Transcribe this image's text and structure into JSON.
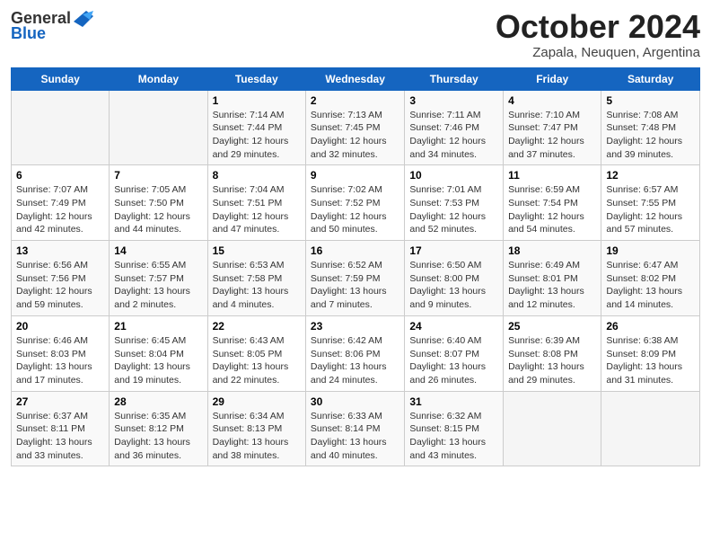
{
  "header": {
    "logo_general": "General",
    "logo_blue": "Blue",
    "month_title": "October 2024",
    "subtitle": "Zapala, Neuquen, Argentina"
  },
  "days_of_week": [
    "Sunday",
    "Monday",
    "Tuesday",
    "Wednesday",
    "Thursday",
    "Friday",
    "Saturday"
  ],
  "weeks": [
    [
      {
        "day": "",
        "sunrise": "",
        "sunset": "",
        "daylight": ""
      },
      {
        "day": "",
        "sunrise": "",
        "sunset": "",
        "daylight": ""
      },
      {
        "day": "1",
        "sunrise": "Sunrise: 7:14 AM",
        "sunset": "Sunset: 7:44 PM",
        "daylight": "Daylight: 12 hours and 29 minutes."
      },
      {
        "day": "2",
        "sunrise": "Sunrise: 7:13 AM",
        "sunset": "Sunset: 7:45 PM",
        "daylight": "Daylight: 12 hours and 32 minutes."
      },
      {
        "day": "3",
        "sunrise": "Sunrise: 7:11 AM",
        "sunset": "Sunset: 7:46 PM",
        "daylight": "Daylight: 12 hours and 34 minutes."
      },
      {
        "day": "4",
        "sunrise": "Sunrise: 7:10 AM",
        "sunset": "Sunset: 7:47 PM",
        "daylight": "Daylight: 12 hours and 37 minutes."
      },
      {
        "day": "5",
        "sunrise": "Sunrise: 7:08 AM",
        "sunset": "Sunset: 7:48 PM",
        "daylight": "Daylight: 12 hours and 39 minutes."
      }
    ],
    [
      {
        "day": "6",
        "sunrise": "Sunrise: 7:07 AM",
        "sunset": "Sunset: 7:49 PM",
        "daylight": "Daylight: 12 hours and 42 minutes."
      },
      {
        "day": "7",
        "sunrise": "Sunrise: 7:05 AM",
        "sunset": "Sunset: 7:50 PM",
        "daylight": "Daylight: 12 hours and 44 minutes."
      },
      {
        "day": "8",
        "sunrise": "Sunrise: 7:04 AM",
        "sunset": "Sunset: 7:51 PM",
        "daylight": "Daylight: 12 hours and 47 minutes."
      },
      {
        "day": "9",
        "sunrise": "Sunrise: 7:02 AM",
        "sunset": "Sunset: 7:52 PM",
        "daylight": "Daylight: 12 hours and 50 minutes."
      },
      {
        "day": "10",
        "sunrise": "Sunrise: 7:01 AM",
        "sunset": "Sunset: 7:53 PM",
        "daylight": "Daylight: 12 hours and 52 minutes."
      },
      {
        "day": "11",
        "sunrise": "Sunrise: 6:59 AM",
        "sunset": "Sunset: 7:54 PM",
        "daylight": "Daylight: 12 hours and 54 minutes."
      },
      {
        "day": "12",
        "sunrise": "Sunrise: 6:57 AM",
        "sunset": "Sunset: 7:55 PM",
        "daylight": "Daylight: 12 hours and 57 minutes."
      }
    ],
    [
      {
        "day": "13",
        "sunrise": "Sunrise: 6:56 AM",
        "sunset": "Sunset: 7:56 PM",
        "daylight": "Daylight: 12 hours and 59 minutes."
      },
      {
        "day": "14",
        "sunrise": "Sunrise: 6:55 AM",
        "sunset": "Sunset: 7:57 PM",
        "daylight": "Daylight: 13 hours and 2 minutes."
      },
      {
        "day": "15",
        "sunrise": "Sunrise: 6:53 AM",
        "sunset": "Sunset: 7:58 PM",
        "daylight": "Daylight: 13 hours and 4 minutes."
      },
      {
        "day": "16",
        "sunrise": "Sunrise: 6:52 AM",
        "sunset": "Sunset: 7:59 PM",
        "daylight": "Daylight: 13 hours and 7 minutes."
      },
      {
        "day": "17",
        "sunrise": "Sunrise: 6:50 AM",
        "sunset": "Sunset: 8:00 PM",
        "daylight": "Daylight: 13 hours and 9 minutes."
      },
      {
        "day": "18",
        "sunrise": "Sunrise: 6:49 AM",
        "sunset": "Sunset: 8:01 PM",
        "daylight": "Daylight: 13 hours and 12 minutes."
      },
      {
        "day": "19",
        "sunrise": "Sunrise: 6:47 AM",
        "sunset": "Sunset: 8:02 PM",
        "daylight": "Daylight: 13 hours and 14 minutes."
      }
    ],
    [
      {
        "day": "20",
        "sunrise": "Sunrise: 6:46 AM",
        "sunset": "Sunset: 8:03 PM",
        "daylight": "Daylight: 13 hours and 17 minutes."
      },
      {
        "day": "21",
        "sunrise": "Sunrise: 6:45 AM",
        "sunset": "Sunset: 8:04 PM",
        "daylight": "Daylight: 13 hours and 19 minutes."
      },
      {
        "day": "22",
        "sunrise": "Sunrise: 6:43 AM",
        "sunset": "Sunset: 8:05 PM",
        "daylight": "Daylight: 13 hours and 22 minutes."
      },
      {
        "day": "23",
        "sunrise": "Sunrise: 6:42 AM",
        "sunset": "Sunset: 8:06 PM",
        "daylight": "Daylight: 13 hours and 24 minutes."
      },
      {
        "day": "24",
        "sunrise": "Sunrise: 6:40 AM",
        "sunset": "Sunset: 8:07 PM",
        "daylight": "Daylight: 13 hours and 26 minutes."
      },
      {
        "day": "25",
        "sunrise": "Sunrise: 6:39 AM",
        "sunset": "Sunset: 8:08 PM",
        "daylight": "Daylight: 13 hours and 29 minutes."
      },
      {
        "day": "26",
        "sunrise": "Sunrise: 6:38 AM",
        "sunset": "Sunset: 8:09 PM",
        "daylight": "Daylight: 13 hours and 31 minutes."
      }
    ],
    [
      {
        "day": "27",
        "sunrise": "Sunrise: 6:37 AM",
        "sunset": "Sunset: 8:11 PM",
        "daylight": "Daylight: 13 hours and 33 minutes."
      },
      {
        "day": "28",
        "sunrise": "Sunrise: 6:35 AM",
        "sunset": "Sunset: 8:12 PM",
        "daylight": "Daylight: 13 hours and 36 minutes."
      },
      {
        "day": "29",
        "sunrise": "Sunrise: 6:34 AM",
        "sunset": "Sunset: 8:13 PM",
        "daylight": "Daylight: 13 hours and 38 minutes."
      },
      {
        "day": "30",
        "sunrise": "Sunrise: 6:33 AM",
        "sunset": "Sunset: 8:14 PM",
        "daylight": "Daylight: 13 hours and 40 minutes."
      },
      {
        "day": "31",
        "sunrise": "Sunrise: 6:32 AM",
        "sunset": "Sunset: 8:15 PM",
        "daylight": "Daylight: 13 hours and 43 minutes."
      },
      {
        "day": "",
        "sunrise": "",
        "sunset": "",
        "daylight": ""
      },
      {
        "day": "",
        "sunrise": "",
        "sunset": "",
        "daylight": ""
      }
    ]
  ]
}
